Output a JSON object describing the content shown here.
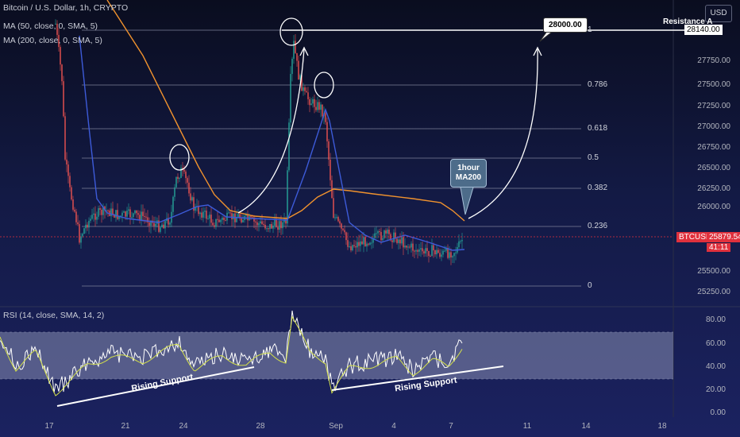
{
  "header": {
    "symbol_title": "Bitcoin / U.S. Dollar, 1h, CRYPTO",
    "ma50_legend": "MA (50, close, 0, SMA, 5)",
    "ma200_legend": "MA (200, close, 0, SMA, 5)",
    "currency_button": "USD"
  },
  "price_axis": {
    "labels": [
      "28140.00",
      "27750.00",
      "27500.00",
      "27250.00",
      "27000.00",
      "26750.00",
      "26500.00",
      "26250.00",
      "26000.00",
      "25500.00",
      "25250.00"
    ]
  },
  "fib_levels": [
    {
      "label": "1"
    },
    {
      "label": "0.786"
    },
    {
      "label": "0.618"
    },
    {
      "label": "0.5"
    },
    {
      "label": "0.382"
    },
    {
      "label": "0.236"
    },
    {
      "label": "0"
    }
  ],
  "annotations": {
    "resistance": "Resistance A",
    "target_callout": "28000.00",
    "ma_callout_line1": "1hour",
    "ma_callout_line2": "MA200",
    "rising_support_1": "Rising Support",
    "rising_support_2": "Rising Support"
  },
  "current_price": {
    "ticker": "BTCUSD",
    "price": "25879.54",
    "countdown": "41:11"
  },
  "rsi": {
    "legend": "RSI (14, close, SMA, 14, 2)",
    "axis_labels": [
      "80.00",
      "60.00",
      "40.00",
      "20.00",
      "0.00"
    ]
  },
  "time_axis": {
    "labels": [
      "17",
      "21",
      "24",
      "28",
      "Sep",
      "4",
      "7",
      "11",
      "14",
      "18"
    ]
  },
  "colors": {
    "ma50": "#3d5bd9",
    "ma200": "#f0922e",
    "candle_up": "#26a69a",
    "candle_down": "#ef5350",
    "rsi_line": "#ffffff",
    "rsi_ma": "#d4e04a",
    "band": "#c8cfe8"
  }
}
